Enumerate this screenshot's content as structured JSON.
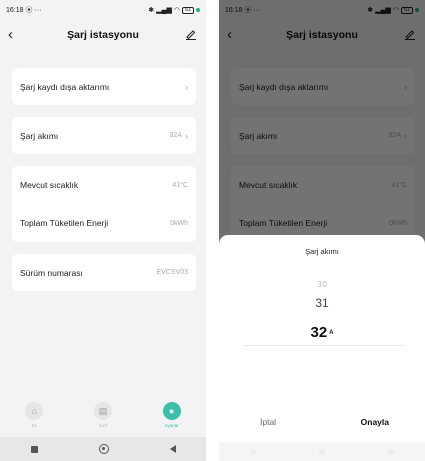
{
  "status_bar": {
    "time": "16:18",
    "notif": "⦿ ···",
    "battery": "61"
  },
  "nav": {
    "title": "Şarj istasyonu"
  },
  "settings": {
    "export": {
      "label": "Şarj kaydı dışa aktarımı"
    },
    "current": {
      "label": "Şarj akımı",
      "value": "32A"
    },
    "temperature": {
      "label": "Mevcut sıcaklık",
      "value": "41°C"
    },
    "energy": {
      "label": "Toplam Tüketilen Enerji",
      "value": "0kWh"
    },
    "version": {
      "label": "Sürüm numarası",
      "value": "EVCSV03"
    }
  },
  "tabs": [
    {
      "label": "Ev",
      "icon": "home-icon"
    },
    {
      "label": "Kart",
      "icon": "card-icon"
    },
    {
      "label": "Ayarlar",
      "icon": "settings-icon",
      "active": true
    }
  ],
  "picker": {
    "title": "Şarj akımı",
    "options": [
      "30",
      "31",
      "32"
    ],
    "selected": "32",
    "unit": "A",
    "cancel_label": "İptal",
    "confirm_label": "Onayla"
  },
  "colors": {
    "accent": "#3bbfa8",
    "background": "#f3f3f5"
  }
}
